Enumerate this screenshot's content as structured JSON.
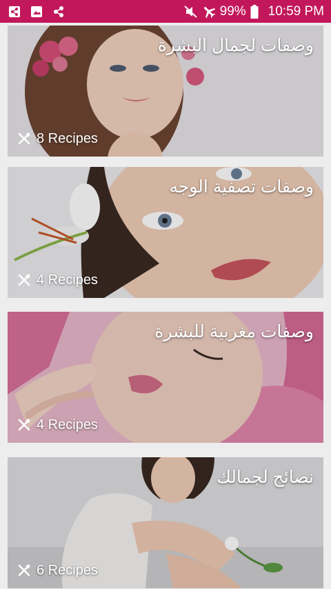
{
  "status_bar": {
    "battery": "99%",
    "time": "10:59 PM",
    "icons": [
      "share-icon",
      "image-icon",
      "share-icon",
      "mute-icon",
      "airplane-icon",
      "battery-icon"
    ]
  },
  "categories": [
    {
      "title": "وصفات لجمال البشرة",
      "count_label": "8 Recipes",
      "icon": "fork-knife-icon"
    },
    {
      "title": "وصفات تصفية الوجه",
      "count_label": "4 Recipes",
      "icon": "fork-knife-icon"
    },
    {
      "title": "وصفات مغربية للبشرة",
      "count_label": "4 Recipes",
      "icon": "fork-knife-icon"
    },
    {
      "title": "نصائح لجمالك",
      "count_label": "6 Recipes",
      "icon": "fork-knife-icon"
    }
  ],
  "colors": {
    "status_bar": "#c2185b",
    "background": "#ededed"
  }
}
